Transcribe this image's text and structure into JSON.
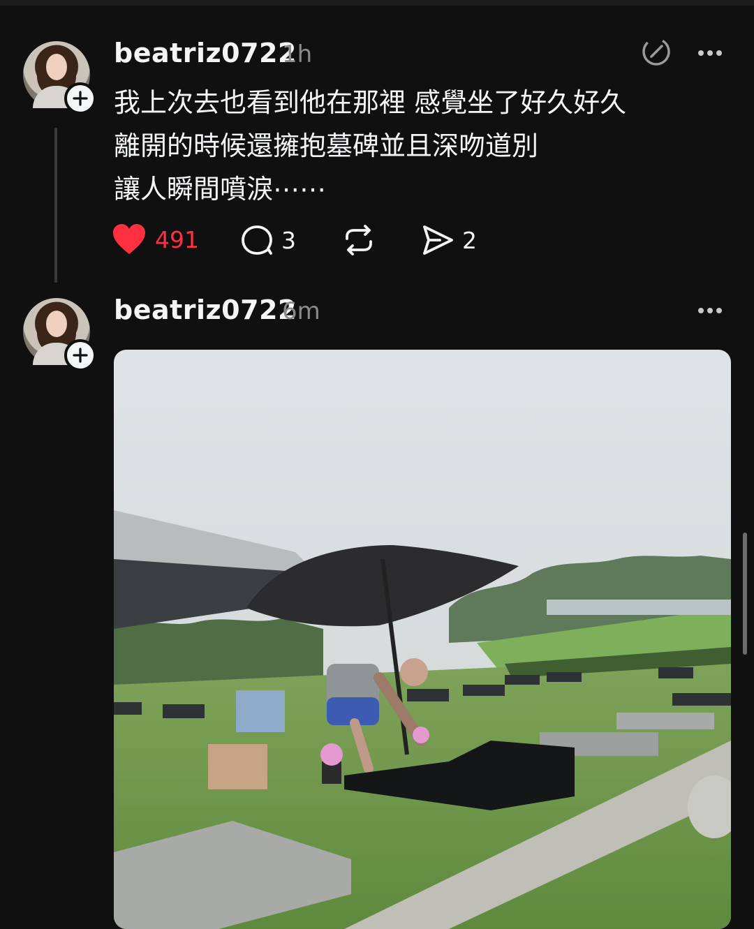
{
  "posts": [
    {
      "username": "beatriz0722",
      "time": "1h",
      "lines": [
        "我上次去也看到他在那裡 感覺坐了好久好久",
        "離開的時候還擁抱墓碑並且深吻道別",
        "讓人瞬間噴淚⋯⋯"
      ],
      "likes": "491",
      "comments": "3",
      "shares": "2"
    },
    {
      "username": "beatriz0722",
      "time": "6m"
    }
  ],
  "icons": {
    "like": "heart-icon",
    "comment": "comment-icon",
    "repost": "repost-icon",
    "share": "share-icon",
    "more": "more-icon",
    "follow": "plus-icon",
    "edit": "edit-icon"
  },
  "colors": {
    "background": "#101010",
    "liked": "#ff3040",
    "muted": "#8a8a8a"
  }
}
